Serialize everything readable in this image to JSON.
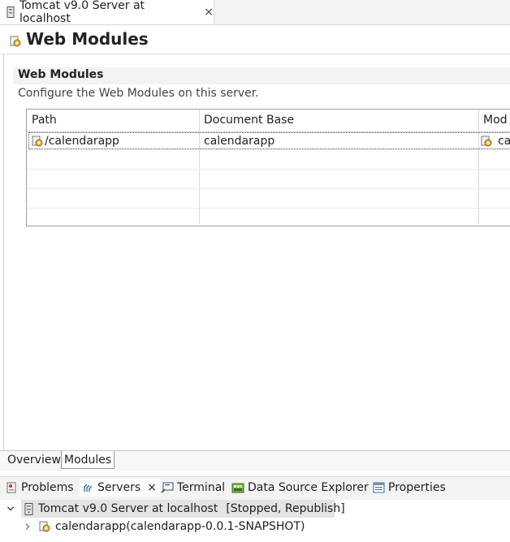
{
  "editor_tab": {
    "title": "Tomcat v9.0 Server at localhost",
    "close": "×"
  },
  "page": {
    "title": "Web Modules"
  },
  "section": {
    "title": "Web Modules",
    "description": "Configure the Web Modules on this server."
  },
  "table": {
    "columns": [
      "Path",
      "Document Base",
      "Mod"
    ],
    "rows": [
      {
        "path": "/calendarapp",
        "document_base": "calendarapp",
        "module": "ca"
      }
    ]
  },
  "page_tabs": [
    "Overview",
    "Modules"
  ],
  "views": {
    "tabs": [
      {
        "label": "Problems",
        "icon": "problems-icon"
      },
      {
        "label": "Servers",
        "icon": "servers-icon",
        "close": "×"
      },
      {
        "label": "Terminal",
        "icon": "terminal-icon"
      },
      {
        "label": "Data Source Explorer",
        "icon": "data-source-icon"
      },
      {
        "label": "Properties",
        "icon": "properties-icon"
      }
    ]
  },
  "tree": {
    "server": {
      "label": "Tomcat v9.0 Server at localhost",
      "status": "[Stopped, Republish]"
    },
    "module": {
      "label": "calendarapp(calendarapp-0.0.1-SNAPSHOT)"
    }
  }
}
